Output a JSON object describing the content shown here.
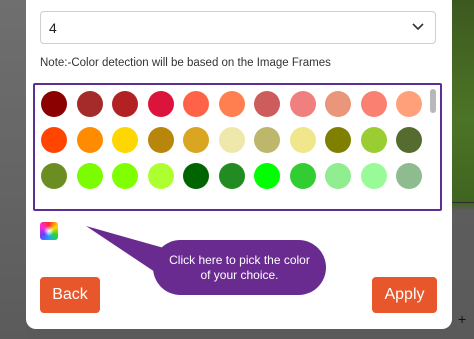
{
  "dialog": {
    "select": {
      "value": "4"
    },
    "note": "Note:-Color detection will be based on the Image Frames",
    "swatches": [
      "#8b0000",
      "#a52a2a",
      "#b22222",
      "#dc143c",
      "#ff6347",
      "#ff7f50",
      "#cd5c5c",
      "#f08080",
      "#e9967a",
      "#fa8072",
      "#ffa07a",
      "#ff4500",
      "#ff8c00",
      "#ffd700",
      "#b8860b",
      "#daa520",
      "#eee8aa",
      "#bdb76b",
      "#f0e68c",
      "#808000",
      "#9acd32",
      "#556b2f",
      "#6b8e23",
      "#7cfc00",
      "#7fff00",
      "#adff2f",
      "#006400",
      "#228b22",
      "#00ff00",
      "#32cd32",
      "#90ee90",
      "#98fb98",
      "#8fbc8f"
    ],
    "tooltip": "Click here to pick the color of your choice.",
    "back_label": "Back",
    "apply_label": "Apply"
  },
  "colors": {
    "accent": "#e8572b",
    "palette_border": "#5a2f91",
    "tooltip_bg": "#6a2b91"
  }
}
